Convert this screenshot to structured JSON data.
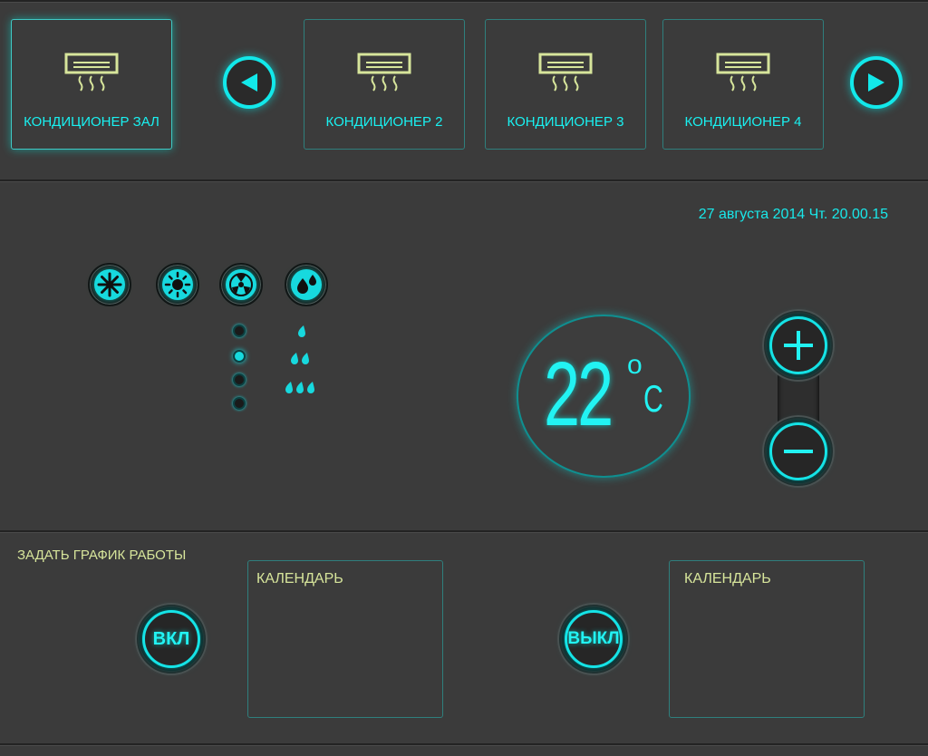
{
  "header": {
    "units": [
      {
        "label": "КОНДИЦИОНЕР ЗАЛ",
        "active": true
      },
      {
        "label": "КОНДИЦИОНЕР 2",
        "active": false
      },
      {
        "label": "КОНДИЦИОНЕР 3",
        "active": false
      },
      {
        "label": "КОНДИЦИОНЕР 4",
        "active": false
      }
    ],
    "unit_icon": "air-conditioner-icon",
    "prev_icon": "triangle-left-icon",
    "next_icon": "triangle-right-icon"
  },
  "status": {
    "datetime": "27 августа 2014 Чт. 20.00.15"
  },
  "modes": {
    "items": [
      {
        "name": "cool",
        "icon": "snowflake-icon"
      },
      {
        "name": "heat",
        "icon": "sun-icon"
      },
      {
        "name": "fan",
        "icon": "fan-icon"
      },
      {
        "name": "dry",
        "icon": "droplets-icon"
      }
    ]
  },
  "fan_speed": {
    "levels": 4,
    "selected_level": 2
  },
  "humidity_levels": {
    "icon": "drop-icon",
    "levels": [
      1,
      2,
      3
    ]
  },
  "temperature": {
    "value": "22",
    "degree": "o",
    "unit": "C"
  },
  "stepper": {
    "plus_icon": "plus-icon",
    "minus_icon": "minus-icon"
  },
  "schedule": {
    "title": "ЗАДАТЬ ГРАФИК РАБОТЫ",
    "on_label": "ВКЛ",
    "off_label": "ВЫКЛ",
    "on_calendar_label": "КАЛЕНДАРЬ",
    "off_calendar_label": "КАЛЕНДАРЬ"
  },
  "colors": {
    "accent": "#17d9de",
    "icon_yellow": "#d7e59b",
    "background": "#3b3b3b"
  }
}
